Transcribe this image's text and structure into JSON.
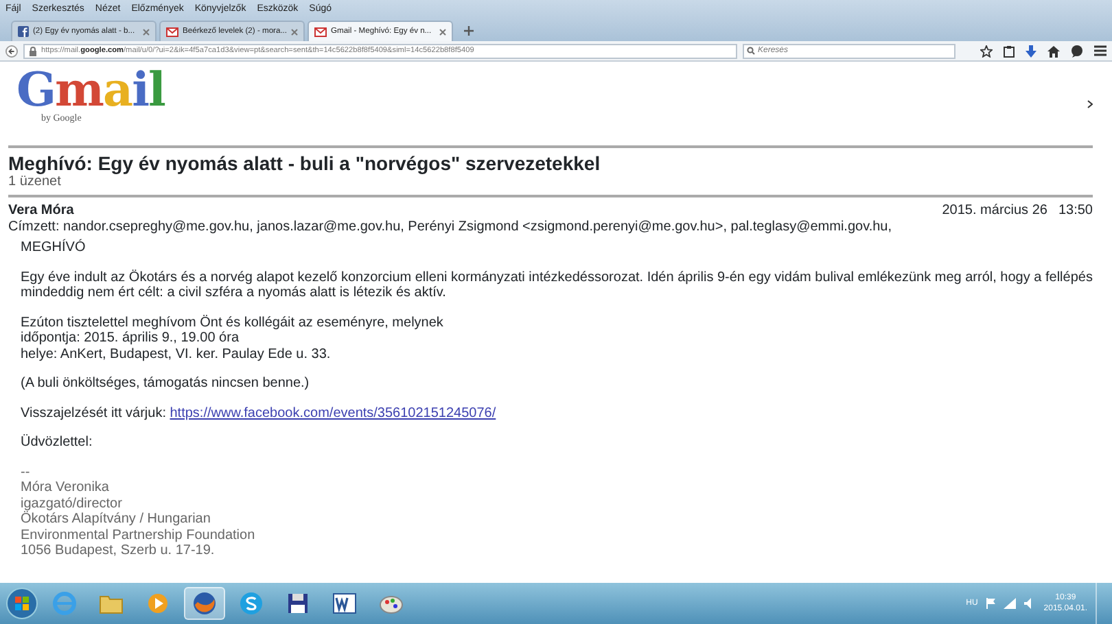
{
  "menu": [
    "Fájl",
    "Szerkesztés",
    "Nézet",
    "Előzmények",
    "Könyvjelzők",
    "Eszközök",
    "Súgó"
  ],
  "tabs": [
    {
      "title": "(2) Egy év nyomás alatt - b...",
      "kind": "facebook",
      "selected": false
    },
    {
      "title": "Beérkező levelek (2) - mora...",
      "kind": "mail",
      "selected": false
    },
    {
      "title": "Gmail - Meghívó: Egy év n...",
      "kind": "mail",
      "selected": true
    }
  ],
  "url": {
    "prefix": "https://mail.",
    "host": "google.com",
    "path": "/mail/u/0/?ui=2&ik=4f5a7ca1d3&view=pt&search=sent&th=14c5622b8f8f5409&siml=14c5622b8f8f5409"
  },
  "search": {
    "placeholder": "Keresés"
  },
  "logo": {
    "text": "Gmail",
    "byline": "by Google"
  },
  "subject": "Meghívó: Egy év nyomás alatt - buli a \"norvégos\" szervezetekkel",
  "message_count": "1 üzenet",
  "message": {
    "sender": "Vera Móra",
    "date": "2015. március 26",
    "time": "13:50",
    "recipients": "Címzett: nandor.csepreghy@me.gov.hu, janos.lazar@me.gov.hu, Perényi Zsigmond <zsigmond.perenyi@me.gov.hu>, pal.teglasy@emmi.gov.hu,",
    "body": [
      {
        "kind": "text",
        "lines": [
          "MEGHÍVÓ"
        ]
      },
      {
        "kind": "text",
        "lines": [
          "Egy éve indult az Ökotárs és a norvég alapot kezelő konzorcium elleni kormányzati intézkedéssorozat. Idén április 9-én egy vidám bulival emlékezünk meg arról, hogy a fellépés mindeddig nem ért célt: a civil szféra a nyomás alatt is létezik és aktív."
        ]
      },
      {
        "kind": "text",
        "lines": [
          "Ezúton tisztelettel meghívom Önt és kollégáit az eseményre, melynek",
          "időpontja: 2015. április 9., 19.00 óra",
          "helye: AnKert, Budapest, VI. ker. Paulay Ede u. 33."
        ]
      },
      {
        "kind": "text",
        "lines": [
          "(A buli önköltséges, támogatás nincsen benne.)"
        ]
      },
      {
        "kind": "link",
        "text": "Visszajelzését itt várjuk: ",
        "link": "https://www.facebook.com/events/356102151245076/"
      },
      {
        "kind": "text",
        "lines": [
          "Üdvözlettel:"
        ]
      },
      {
        "kind": "signature",
        "lines": [
          "--",
          "Móra Veronika",
          "igazgató/director",
          "Ökotárs Alapítvány / Hungarian",
          "Environmental Partnership Foundation",
          "1056 Budapest, Szerb u. 17-19."
        ]
      }
    ]
  },
  "taskbar": {
    "language": "HU",
    "time": "10:39",
    "date": "2015.04.01."
  }
}
